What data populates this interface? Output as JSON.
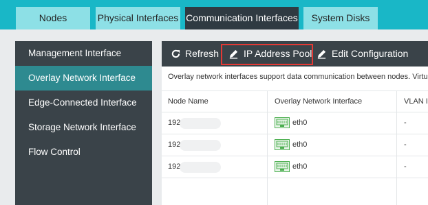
{
  "tabs": [
    {
      "label": "Nodes"
    },
    {
      "label": "Physical Interfaces"
    },
    {
      "label": "Communication Interfaces"
    },
    {
      "label": "System Disks"
    }
  ],
  "sidebar": {
    "items": [
      {
        "label": "Management Interface"
      },
      {
        "label": "Overlay Network Interface"
      },
      {
        "label": "Edge-Connected Interface"
      },
      {
        "label": "Storage Network Interface"
      },
      {
        "label": "Flow Control"
      }
    ]
  },
  "toolbar": {
    "refresh_label": "Refresh",
    "ip_pool_label": "IP Address Pool",
    "edit_label": "Edit Configuration"
  },
  "info_text": "Overlay network interfaces support data communication between nodes. Virtual",
  "table": {
    "headers": [
      "Node Name",
      "Overlay Network Interface",
      "VLAN I"
    ],
    "rows": [
      {
        "node": "192",
        "iface": "eth0",
        "vlan": "-"
      },
      {
        "node": "192",
        "iface": "eth0",
        "vlan": "-"
      },
      {
        "node": "192",
        "iface": "eth0",
        "vlan": "-"
      }
    ]
  },
  "colors": {
    "accent": "#19b7c7",
    "active_side": "#2e8a90",
    "dark": "#3a4349",
    "highlight": "#e53935",
    "nic": "#4caf50"
  }
}
